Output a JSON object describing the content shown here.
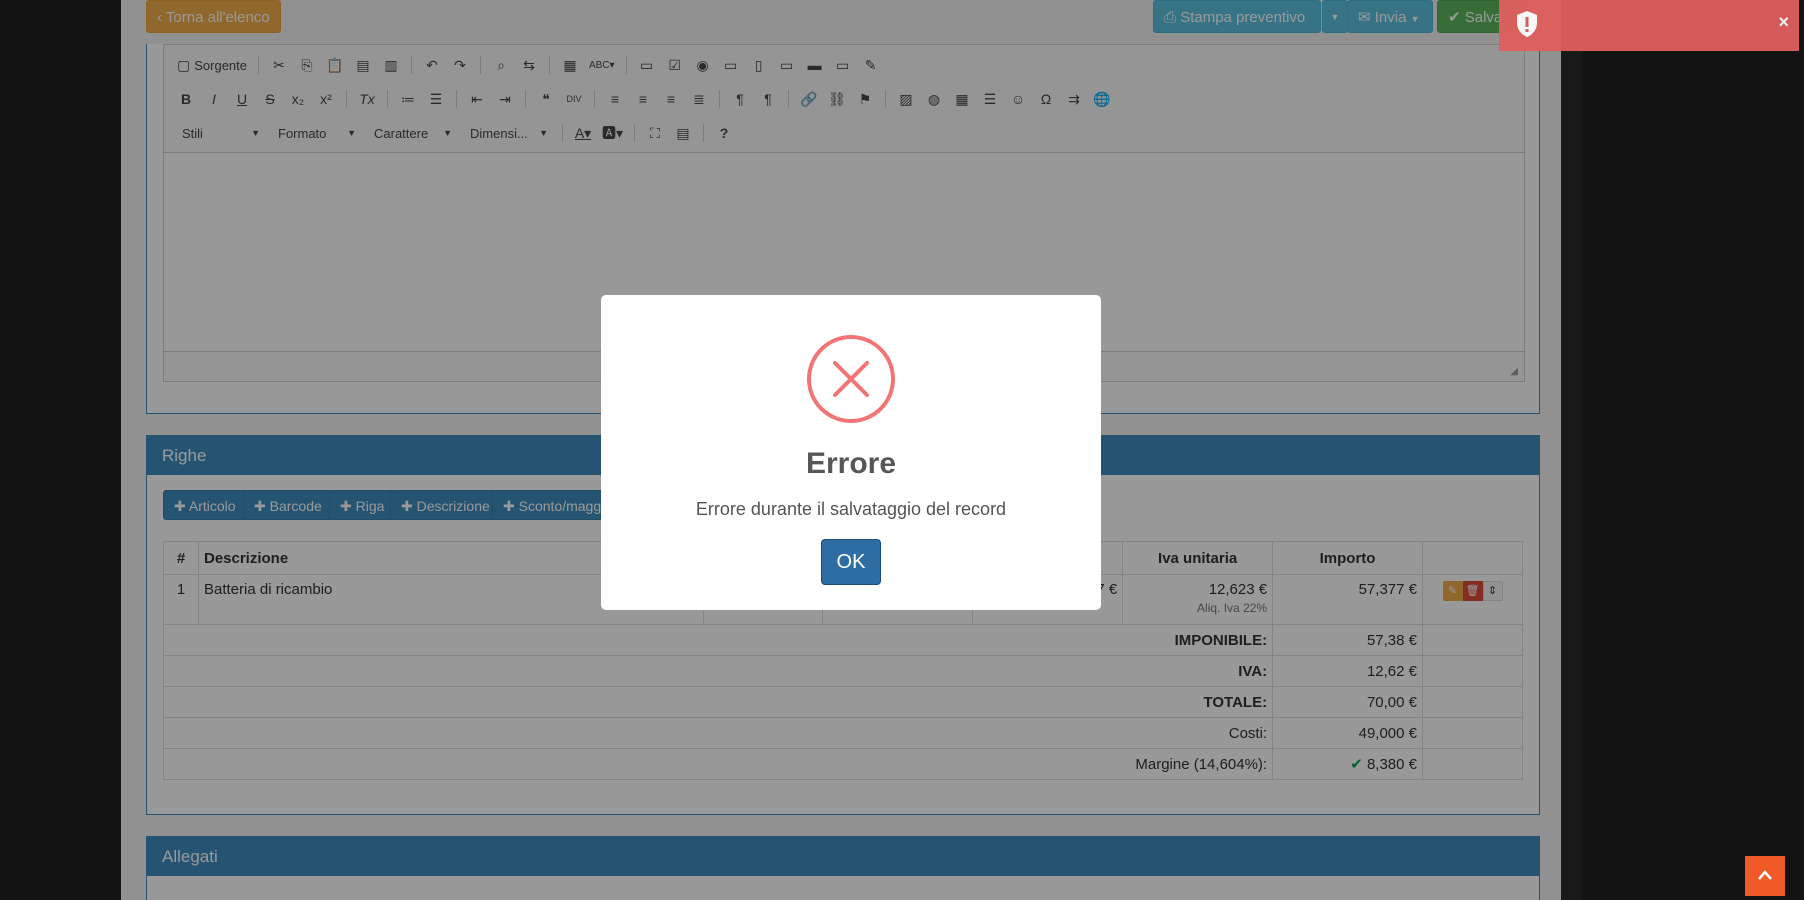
{
  "topbar": {
    "back_label": "Torna all'elenco",
    "print_label": "Stampa preventivo",
    "send_label": "Invia",
    "save_label": "Salva"
  },
  "editor": {
    "source_label": "Sorgente",
    "combos": [
      "Stili",
      "Formato",
      "Carattere",
      "Dimensi..."
    ]
  },
  "righe": {
    "title": "Righe",
    "buttons": [
      "Articolo",
      "Barcode",
      "Riga",
      "Descrizione",
      "Sconto/maggio"
    ],
    "columns": {
      "num": "#",
      "description": "Descrizione",
      "vat": "Iva unitaria",
      "amount": "Importo"
    },
    "row": {
      "num": "1",
      "description": "Batteria di ricambio",
      "partial": "7 €",
      "vat": "12,623 €",
      "vat_note": "Aliq. Iva 22%",
      "amount": "57,377 €"
    },
    "totals": [
      {
        "label": "IMPONIBILE:",
        "value": "57,38 €"
      },
      {
        "label": "IVA:",
        "value": "12,62 €"
      },
      {
        "label": "TOTALE:",
        "value": "70,00 €"
      },
      {
        "label": "Costi:",
        "value": "49,000 €"
      },
      {
        "label": "Margine (14,604%):",
        "value": "8,380 €"
      }
    ]
  },
  "allegati": {
    "title": "Allegati"
  },
  "modal": {
    "title": "Errore",
    "message": "Errore durante il salvataggio del record",
    "ok_label": "OK"
  },
  "colors": {
    "primary": "#3c8dbc",
    "warning": "#f0ad4e",
    "info": "#5bc0de",
    "success": "#5cb85c",
    "danger": "#f27474",
    "toast": "#e05f5f"
  }
}
